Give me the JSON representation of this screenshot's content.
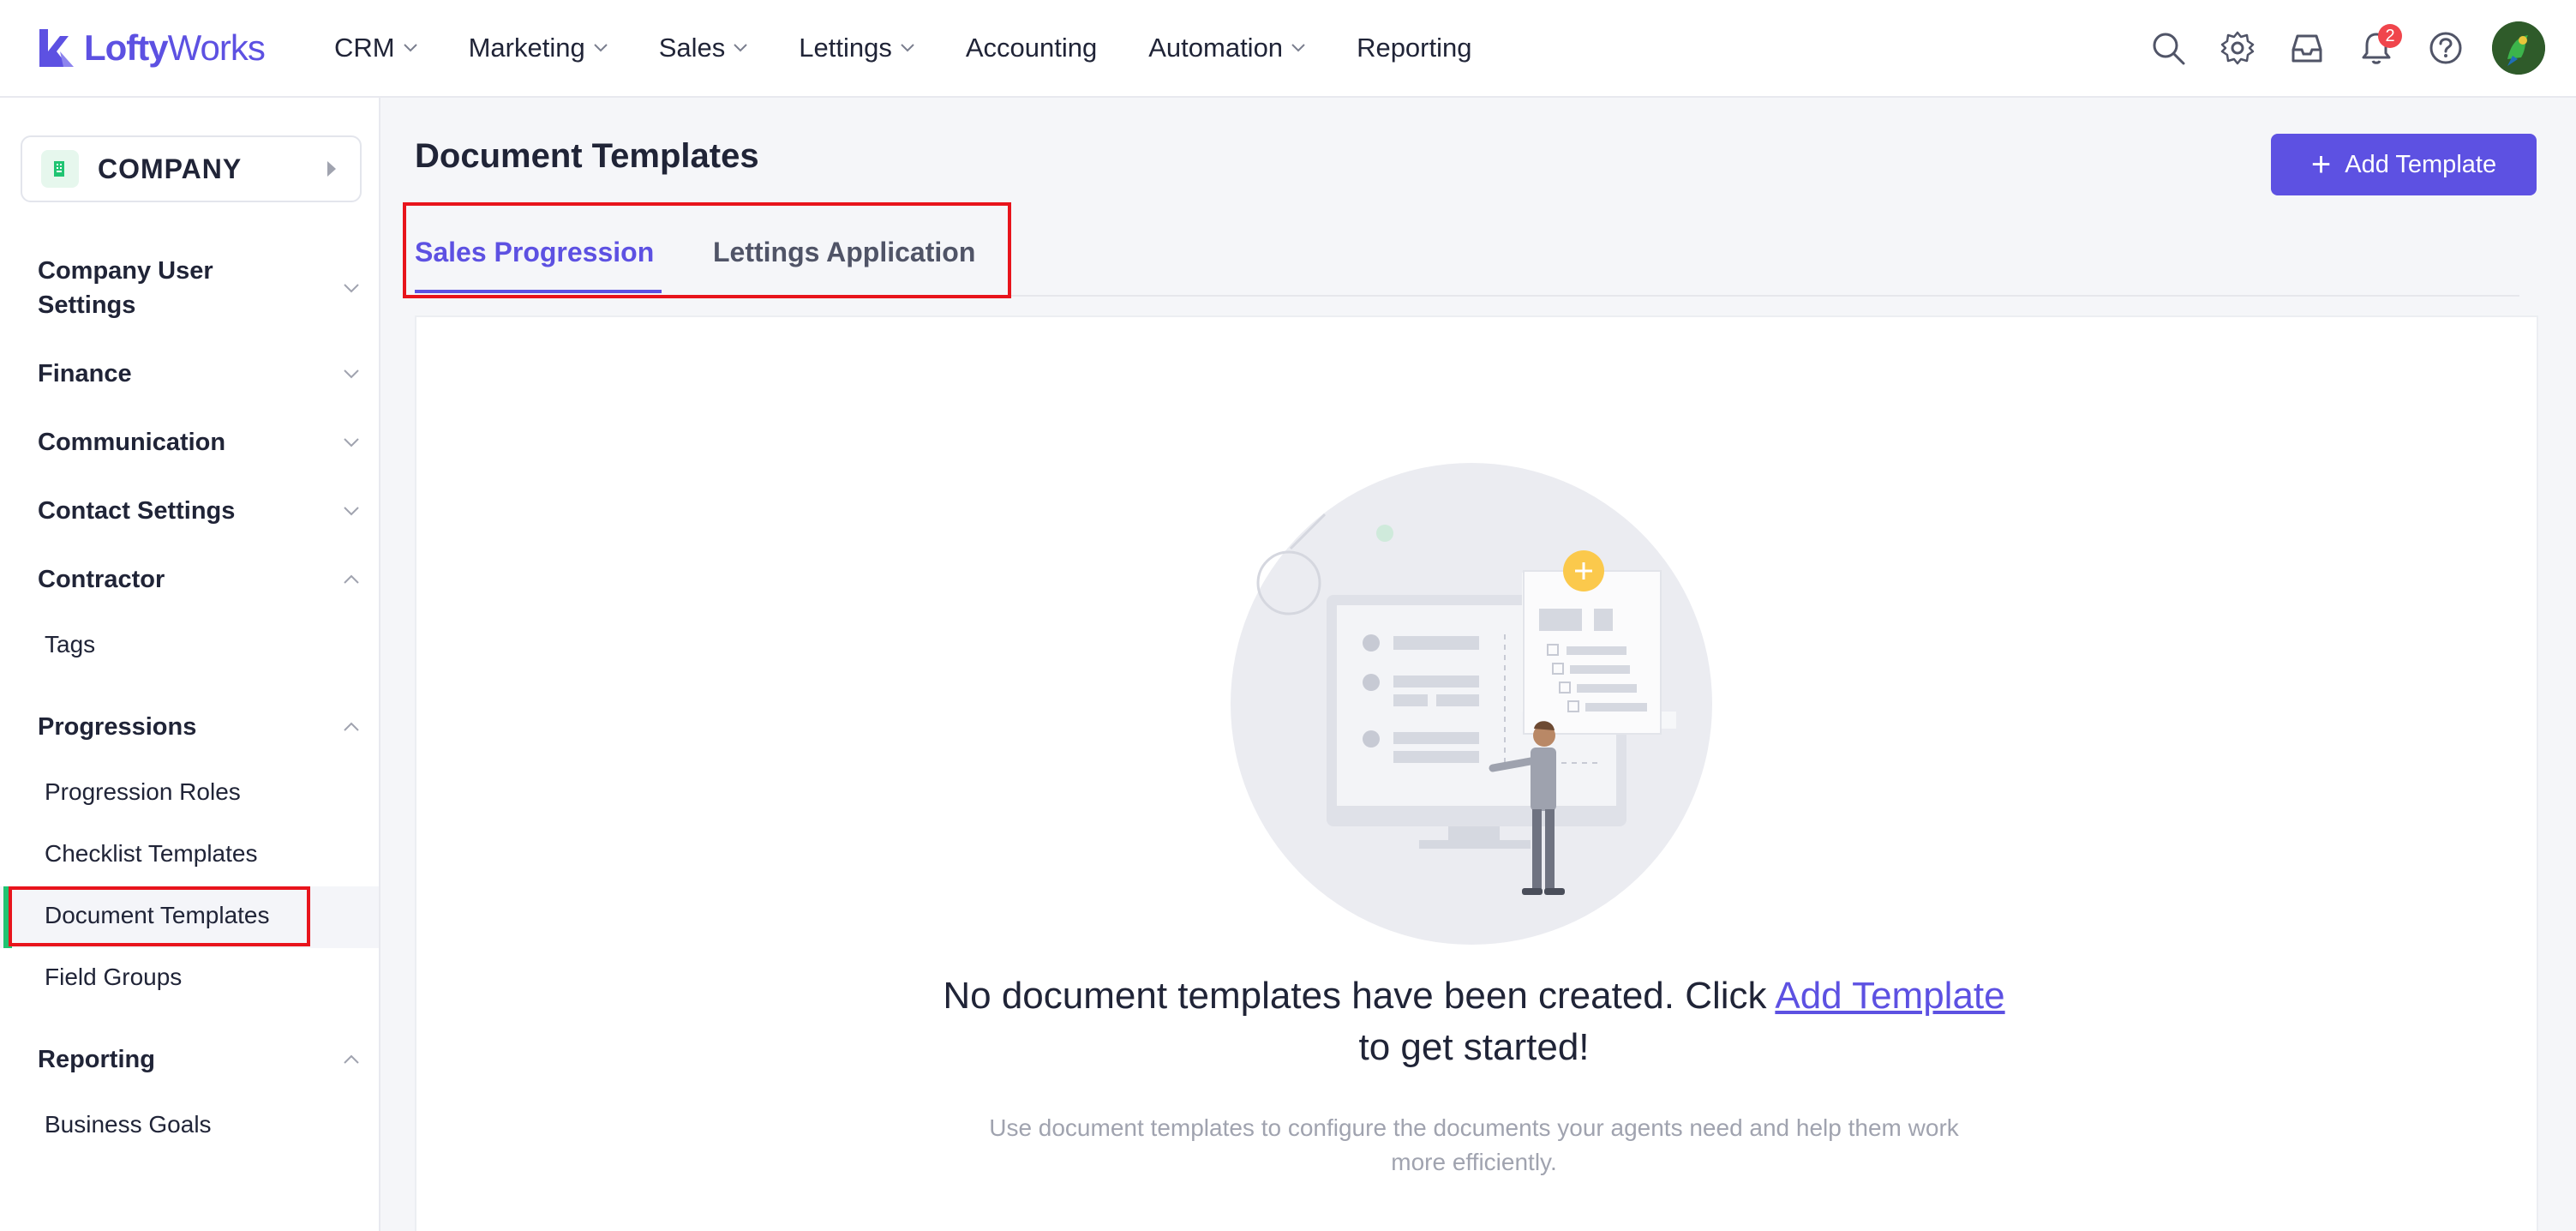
{
  "app": {
    "logo_bold": "Lofty",
    "logo_light": "Works"
  },
  "nav": {
    "items": [
      {
        "label": "CRM",
        "dropdown": true
      },
      {
        "label": "Marketing",
        "dropdown": true
      },
      {
        "label": "Sales",
        "dropdown": true
      },
      {
        "label": "Lettings",
        "dropdown": true
      },
      {
        "label": "Accounting",
        "dropdown": false
      },
      {
        "label": "Automation",
        "dropdown": true
      },
      {
        "label": "Reporting",
        "dropdown": false
      }
    ],
    "icons": [
      "search-icon",
      "gear-icon",
      "inbox-icon",
      "bell-icon",
      "help-icon"
    ],
    "notification_count": "2"
  },
  "sidebar": {
    "company_label": "COMPANY",
    "sections": [
      {
        "label": "Company User Settings",
        "expanded": false
      },
      {
        "label": "Finance",
        "expanded": false
      },
      {
        "label": "Communication",
        "expanded": false
      },
      {
        "label": "Contact Settings",
        "expanded": false
      },
      {
        "label": "Contractor",
        "expanded": true
      },
      {
        "label": "Progressions",
        "expanded": true
      },
      {
        "label": "Reporting",
        "expanded": true
      }
    ],
    "contractor_items": [
      "Tags"
    ],
    "progressions_items": [
      "Progression Roles",
      "Checklist Templates",
      "Document Templates",
      "Field Groups"
    ],
    "reporting_items": [
      "Business Goals"
    ],
    "active_item": "Document Templates"
  },
  "main": {
    "title": "Document Templates",
    "add_button": "Add Template",
    "tabs": [
      {
        "label": "Sales Progression",
        "active": true
      },
      {
        "label": "Lettings Application",
        "active": false
      }
    ],
    "empty": {
      "title_prefix": "No document templates have been created. Click ",
      "title_link": "Add Template",
      "title_suffix": " to get started!",
      "subtitle": "Use document templates to configure the documents your agents need and help them work more efficiently."
    }
  },
  "colors": {
    "accent": "#5d51e2",
    "active_bar": "#20c472",
    "highlight": "#e8141c",
    "badge": "#f0454c"
  }
}
